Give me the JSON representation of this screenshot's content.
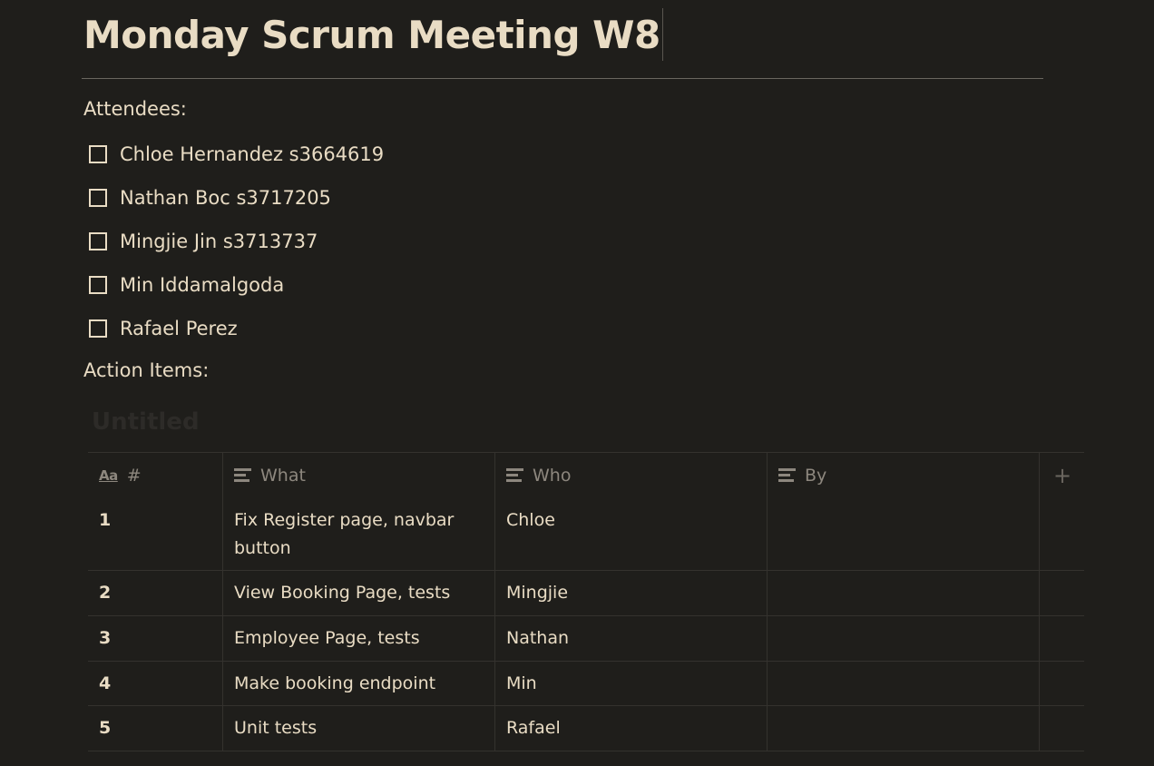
{
  "page": {
    "title": "Monday Scrum Meeting W8",
    "attendees_label": "Attendees:",
    "action_items_label": "Action Items:"
  },
  "attendees": [
    {
      "name": "Chloe Hernandez s3664619",
      "checked": false
    },
    {
      "name": "Nathan Boc s3717205",
      "checked": false
    },
    {
      "name": "Mingjie Jin s3713737",
      "checked": false
    },
    {
      "name": "Min Iddamalgoda",
      "checked": false
    },
    {
      "name": "Rafael Perez",
      "checked": false
    }
  ],
  "database": {
    "title": "Untitled",
    "columns": [
      {
        "label": "#",
        "icon": "title-property-icon"
      },
      {
        "label": "What",
        "icon": "text-property-icon"
      },
      {
        "label": "Who",
        "icon": "text-property-icon"
      },
      {
        "label": "By",
        "icon": "text-property-icon"
      }
    ],
    "add_column_icon": "plus-icon",
    "rows": [
      {
        "num": "1",
        "what": "Fix Register page,  navbar button",
        "who": "Chloe",
        "by": ""
      },
      {
        "num": "2",
        "what": "View Booking Page, tests",
        "who": "Mingjie",
        "by": ""
      },
      {
        "num": "3",
        "what": "Employee Page, tests",
        "who": "Nathan",
        "by": ""
      },
      {
        "num": "4",
        "what": "Make booking endpoint",
        "who": "Min",
        "by": ""
      },
      {
        "num": "5",
        "what": "Unit tests",
        "who": "Rafael",
        "by": ""
      }
    ]
  },
  "colors": {
    "background": "#1f1e1b",
    "text": "#e9dcc4",
    "muted": "#8d877e",
    "border": "#34322e"
  }
}
